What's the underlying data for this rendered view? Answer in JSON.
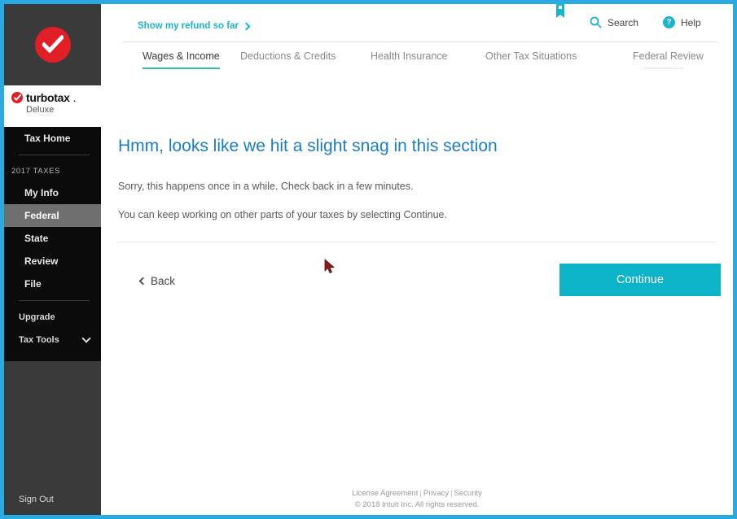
{
  "brand": {
    "name": "turbotax",
    "suffix": ".",
    "edition": "Deluxe",
    "logo_icon": "red-check-circle-icon"
  },
  "sidebar": {
    "tax_home": "Tax Home",
    "section_label": "2017 TAXES",
    "items": [
      {
        "label": "My Info",
        "active": false
      },
      {
        "label": "Federal",
        "active": true
      },
      {
        "label": "State",
        "active": false
      },
      {
        "label": "Review",
        "active": false
      },
      {
        "label": "File",
        "active": false
      }
    ],
    "upgrade": "Upgrade",
    "tax_tools": "Tax Tools",
    "tax_tools_icon": "chevron-down-icon",
    "sign_out": "Sign Out"
  },
  "utility": {
    "refund_link": "Show my refund so far",
    "refund_icon": "chevron-right-icon",
    "bookmark_icon": "bookmark-icon",
    "search_label": "Search",
    "search_icon": "search-icon",
    "help_label": "Help",
    "help_icon": "question-circle-icon"
  },
  "tabs": [
    {
      "label": "Wages & Income",
      "active": true
    },
    {
      "label": "Deductions & Credits",
      "active": false
    },
    {
      "label": "Health Insurance",
      "active": false
    },
    {
      "label": "Other Tax Situations",
      "active": false
    },
    {
      "label": "Federal Review",
      "active": false
    }
  ],
  "content": {
    "title": "Hmm, looks like we hit a slight snag in this section",
    "body_1": "Sorry, this happens once in a while. Check back in a few minutes.",
    "body_2": "You can keep working on other parts of your taxes by selecting Continue.",
    "back_label": "Back",
    "back_icon": "chevron-left-icon",
    "continue_label": "Continue"
  },
  "footer": {
    "license": "License Agreement",
    "privacy": "Privacy",
    "security": "Security",
    "separator": "|",
    "copyright": "© 2018 Intuit Inc. All rights reserved."
  },
  "colors": {
    "frame_blue": "#29ABE2",
    "teal": "#18B5CE",
    "continue_teal": "#0DB3C6",
    "tab_underline": "#2FBFA8",
    "title_blue": "#1A7DC4",
    "logo_red": "#E01F26",
    "cursor_red": "#8B1A1A"
  }
}
